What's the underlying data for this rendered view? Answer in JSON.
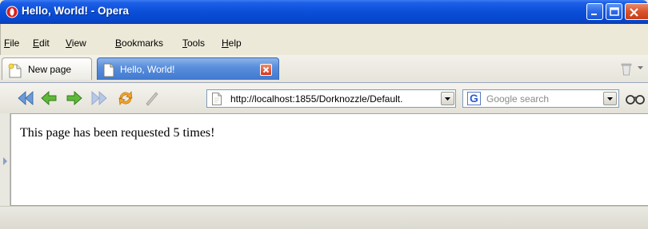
{
  "window": {
    "title": "Hello, World! - Opera"
  },
  "menu": {
    "items": [
      {
        "mnemonic": "F",
        "rest": "ile"
      },
      {
        "mnemonic": "E",
        "rest": "dit"
      },
      {
        "mnemonic": "V",
        "rest": "iew"
      },
      {
        "mnemonic": "B",
        "rest": "ookmarks"
      },
      {
        "mnemonic": "T",
        "rest": "ools"
      },
      {
        "mnemonic": "H",
        "rest": "elp"
      }
    ]
  },
  "tabs": [
    {
      "label": "New page",
      "active": false
    },
    {
      "label": "Hello, World!",
      "active": true
    }
  ],
  "navigation": {
    "address_value": "http://localhost:1855/Dorknozzle/Default.",
    "search_placeholder": "Google search",
    "search_engine_letter": "G"
  },
  "content": {
    "message": "This page has been requested 5 times!"
  },
  "colors": {
    "titlebar": "#0a4fd8",
    "active_tab": "#5b8fdc",
    "close_red": "#d3361e"
  }
}
